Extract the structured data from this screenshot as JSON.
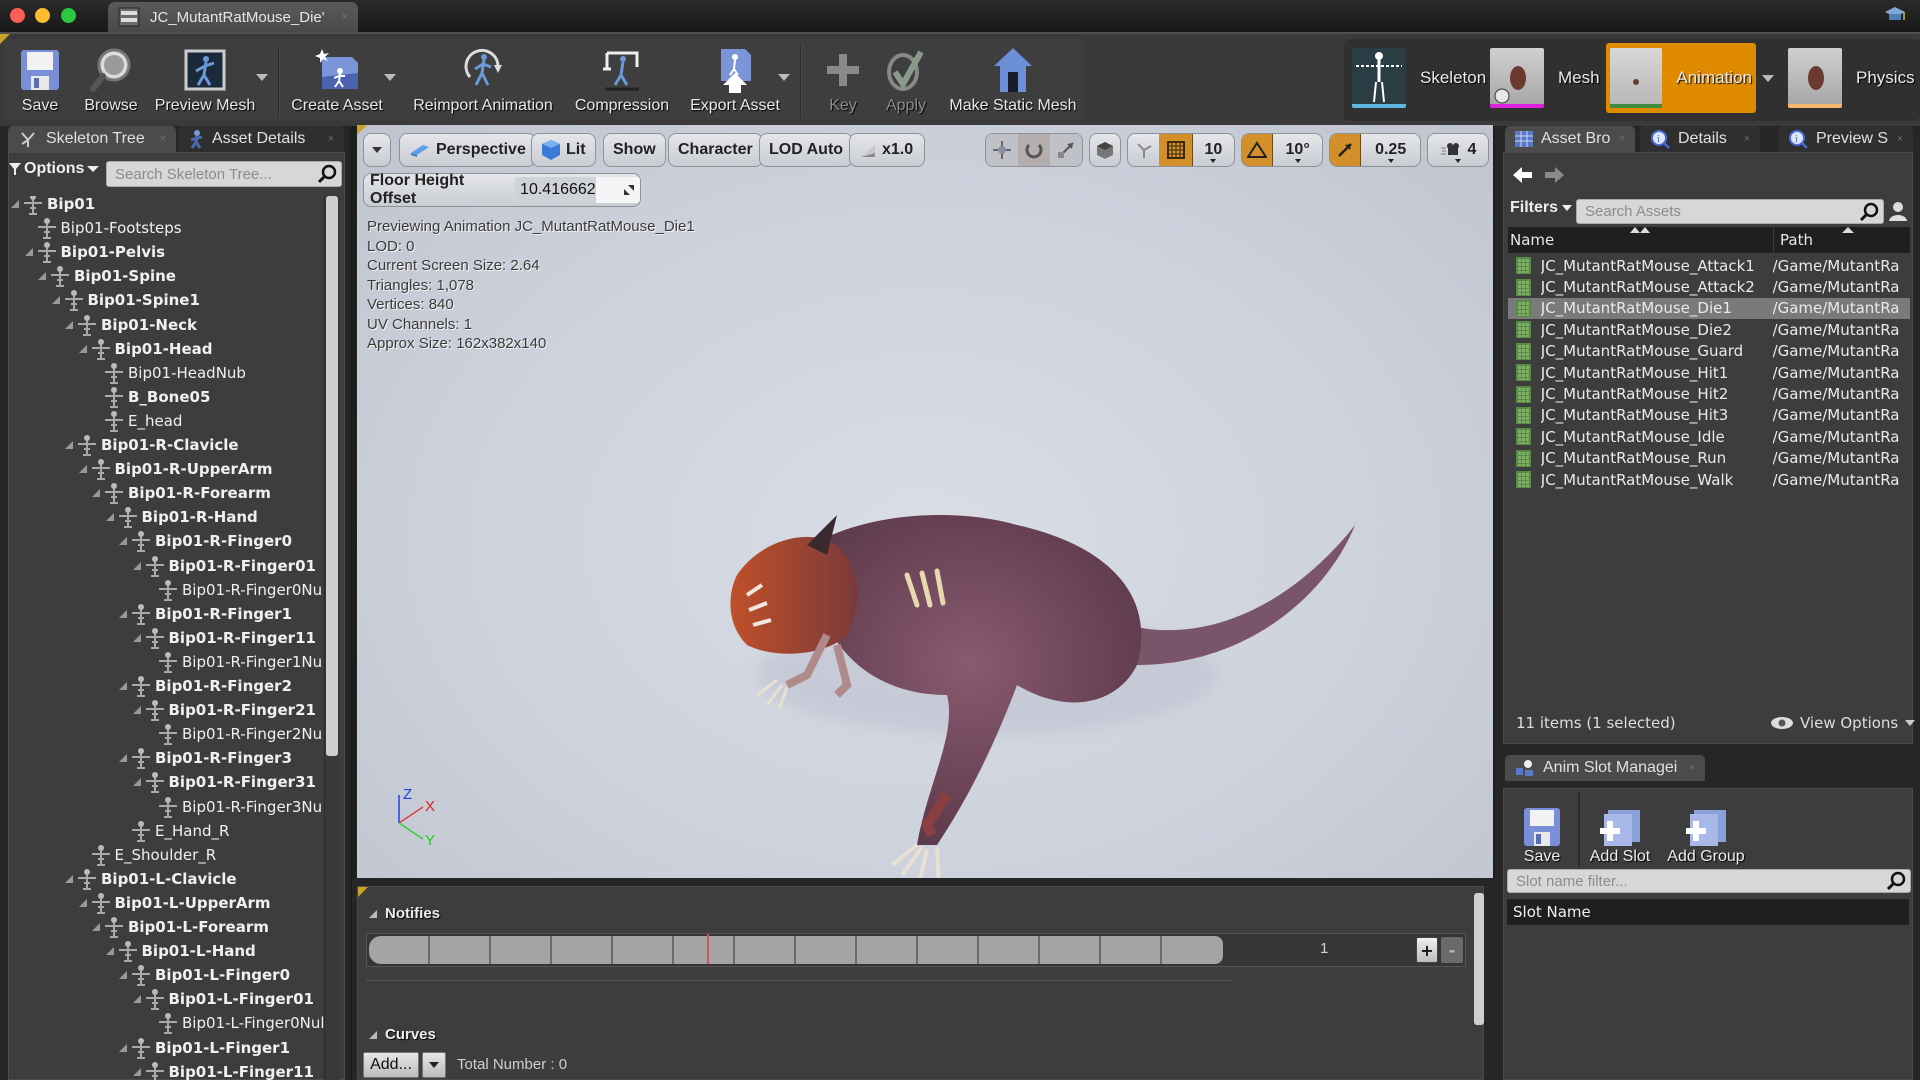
{
  "window": {
    "document_tab": "JC_MutantRatMouse_Die'",
    "close_glyph": "×"
  },
  "toolbar": {
    "buttons": [
      {
        "label": "Save",
        "icon": "save-icon",
        "enabled": true
      },
      {
        "label": "Browse",
        "icon": "browse-icon",
        "enabled": true
      },
      {
        "label": "Preview Mesh",
        "icon": "preview-mesh-icon",
        "enabled": true,
        "dropdown": true
      },
      {
        "label": "Create Asset",
        "icon": "create-asset-icon",
        "enabled": true,
        "dropdown": true
      },
      {
        "label": "Reimport Animation",
        "icon": "reimport-icon",
        "enabled": true
      },
      {
        "label": "Compression",
        "icon": "compression-icon",
        "enabled": true
      },
      {
        "label": "Export Asset",
        "icon": "export-icon",
        "enabled": true,
        "dropdown": true
      },
      {
        "label": "Key",
        "icon": "key-plus-icon",
        "enabled": false
      },
      {
        "label": "Apply",
        "icon": "apply-check-icon",
        "enabled": false
      },
      {
        "label": "Make Static Mesh",
        "icon": "static-mesh-icon",
        "enabled": true
      }
    ]
  },
  "modes": [
    {
      "label": "Skeleton",
      "active": false,
      "color": "#5fb6e0"
    },
    {
      "label": "Mesh",
      "active": false,
      "color": "#e020e0"
    },
    {
      "label": "Animation",
      "active": true,
      "color": "#3f8a3f"
    },
    {
      "label": "Physics",
      "active": false,
      "color": "#f5b66a"
    }
  ],
  "accent_color": "#e08a00",
  "left_panel": {
    "tabs": [
      {
        "label": "Skeleton Tree",
        "active": true
      },
      {
        "label": "Asset Details",
        "active": false
      }
    ],
    "options_label": "Options",
    "search_placeholder": "Search Skeleton Tree...",
    "tree": [
      {
        "label": "Bip01",
        "depth": 0,
        "bold": true,
        "expandable": true
      },
      {
        "label": "Bip01-Footsteps",
        "depth": 1,
        "bold": false,
        "expandable": false
      },
      {
        "label": "Bip01-Pelvis",
        "depth": 1,
        "bold": true,
        "expandable": true
      },
      {
        "label": "Bip01-Spine",
        "depth": 2,
        "bold": true,
        "expandable": true
      },
      {
        "label": "Bip01-Spine1",
        "depth": 3,
        "bold": true,
        "expandable": true
      },
      {
        "label": "Bip01-Neck",
        "depth": 4,
        "bold": true,
        "expandable": true
      },
      {
        "label": "Bip01-Head",
        "depth": 5,
        "bold": true,
        "expandable": true
      },
      {
        "label": "Bip01-HeadNub",
        "depth": 6,
        "bold": false,
        "expandable": false
      },
      {
        "label": "B_Bone05",
        "depth": 6,
        "bold": true,
        "expandable": false
      },
      {
        "label": "E_head",
        "depth": 6,
        "bold": false,
        "expandable": false
      },
      {
        "label": "Bip01-R-Clavicle",
        "depth": 4,
        "bold": true,
        "expandable": true
      },
      {
        "label": "Bip01-R-UpperArm",
        "depth": 5,
        "bold": true,
        "expandable": true
      },
      {
        "label": "Bip01-R-Forearm",
        "depth": 6,
        "bold": true,
        "expandable": true
      },
      {
        "label": "Bip01-R-Hand",
        "depth": 7,
        "bold": true,
        "expandable": true
      },
      {
        "label": "Bip01-R-Finger0",
        "depth": 8,
        "bold": true,
        "expandable": true
      },
      {
        "label": "Bip01-R-Finger01",
        "depth": 9,
        "bold": true,
        "expandable": true
      },
      {
        "label": "Bip01-R-Finger0Nu",
        "depth": 10,
        "bold": false,
        "expandable": false
      },
      {
        "label": "Bip01-R-Finger1",
        "depth": 8,
        "bold": true,
        "expandable": true
      },
      {
        "label": "Bip01-R-Finger11",
        "depth": 9,
        "bold": true,
        "expandable": true
      },
      {
        "label": "Bip01-R-Finger1Nu",
        "depth": 10,
        "bold": false,
        "expandable": false
      },
      {
        "label": "Bip01-R-Finger2",
        "depth": 8,
        "bold": true,
        "expandable": true
      },
      {
        "label": "Bip01-R-Finger21",
        "depth": 9,
        "bold": true,
        "expandable": true
      },
      {
        "label": "Bip01-R-Finger2Nu",
        "depth": 10,
        "bold": false,
        "expandable": false
      },
      {
        "label": "Bip01-R-Finger3",
        "depth": 8,
        "bold": true,
        "expandable": true
      },
      {
        "label": "Bip01-R-Finger31",
        "depth": 9,
        "bold": true,
        "expandable": true
      },
      {
        "label": "Bip01-R-Finger3Nu",
        "depth": 10,
        "bold": false,
        "expandable": false
      },
      {
        "label": "E_Hand_R",
        "depth": 8,
        "bold": false,
        "expandable": false
      },
      {
        "label": "E_Shoulder_R",
        "depth": 5,
        "bold": false,
        "expandable": false
      },
      {
        "label": "Bip01-L-Clavicle",
        "depth": 4,
        "bold": true,
        "expandable": true
      },
      {
        "label": "Bip01-L-UpperArm",
        "depth": 5,
        "bold": true,
        "expandable": true
      },
      {
        "label": "Bip01-L-Forearm",
        "depth": 6,
        "bold": true,
        "expandable": true
      },
      {
        "label": "Bip01-L-Hand",
        "depth": 7,
        "bold": true,
        "expandable": true
      },
      {
        "label": "Bip01-L-Finger0",
        "depth": 8,
        "bold": true,
        "expandable": true
      },
      {
        "label": "Bip01-L-Finger01",
        "depth": 9,
        "bold": true,
        "expandable": true
      },
      {
        "label": "Bip01-L-Finger0Nul",
        "depth": 10,
        "bold": false,
        "expandable": false
      },
      {
        "label": "Bip01-L-Finger1",
        "depth": 8,
        "bold": true,
        "expandable": true
      },
      {
        "label": "Bip01-L-Finger11",
        "depth": 9,
        "bold": true,
        "expandable": true
      }
    ]
  },
  "viewport": {
    "menu_dropdown": "▾",
    "perspective": "Perspective",
    "lit": "Lit",
    "show": "Show",
    "character": "Character",
    "lod": "LOD Auto",
    "speed": "x1.0",
    "grid_snap": "10",
    "rotation_snap": "10°",
    "scale_snap": "0.25",
    "camera_speed": "4",
    "floor_height_label": "Floor Height Offset",
    "floor_height_value": "10.416662",
    "stats": [
      "Previewing Animation JC_MutantRatMouse_Die1",
      "LOD: 0",
      "Current Screen Size: 2.64",
      "Triangles: 1,078",
      "Vertices: 840",
      "UV Channels: 1",
      "Approx Size: 162x382x140"
    ],
    "axis": {
      "x": "X",
      "y": "Y",
      "z": "Z"
    }
  },
  "timeline": {
    "notifies_label": "Notifies",
    "frame_count": "1",
    "plus": "+",
    "minus": "-",
    "curves_label": "Curves",
    "add_label": "Add...",
    "total_number": "Total Number : 0",
    "segments": 14
  },
  "right_panel": {
    "tabs": [
      {
        "label": "Asset Bro",
        "active": true
      },
      {
        "label": "Details",
        "active": false
      },
      {
        "label": "Preview S",
        "active": false
      }
    ],
    "filters_label": "Filters",
    "search_placeholder": "Search Assets",
    "columns": {
      "name": "Name",
      "path": "Path"
    },
    "assets": [
      {
        "name": "JC_MutantRatMouse_Attack1",
        "path": "/Game/MutantRa",
        "selected": false
      },
      {
        "name": "JC_MutantRatMouse_Attack2",
        "path": "/Game/MutantRa",
        "selected": false
      },
      {
        "name": "JC_MutantRatMouse_Die1",
        "path": "/Game/MutantRa",
        "selected": true
      },
      {
        "name": "JC_MutantRatMouse_Die2",
        "path": "/Game/MutantRa",
        "selected": false
      },
      {
        "name": "JC_MutantRatMouse_Guard",
        "path": "/Game/MutantRa",
        "selected": false
      },
      {
        "name": "JC_MutantRatMouse_Hit1",
        "path": "/Game/MutantRa",
        "selected": false
      },
      {
        "name": "JC_MutantRatMouse_Hit2",
        "path": "/Game/MutantRa",
        "selected": false
      },
      {
        "name": "JC_MutantRatMouse_Hit3",
        "path": "/Game/MutantRa",
        "selected": false
      },
      {
        "name": "JC_MutantRatMouse_Idle",
        "path": "/Game/MutantRa",
        "selected": false
      },
      {
        "name": "JC_MutantRatMouse_Run",
        "path": "/Game/MutantRa",
        "selected": false
      },
      {
        "name": "JC_MutantRatMouse_Walk",
        "path": "/Game/MutantRa",
        "selected": false
      }
    ],
    "item_count": "11 items (1 selected)",
    "view_options": "View Options",
    "slot_manager": {
      "tab_label": "Anim Slot Managei",
      "save": "Save",
      "add_slot": "Add Slot",
      "add_group": "Add Group",
      "filter_placeholder": "Slot name filter...",
      "column": "Slot Name"
    }
  }
}
